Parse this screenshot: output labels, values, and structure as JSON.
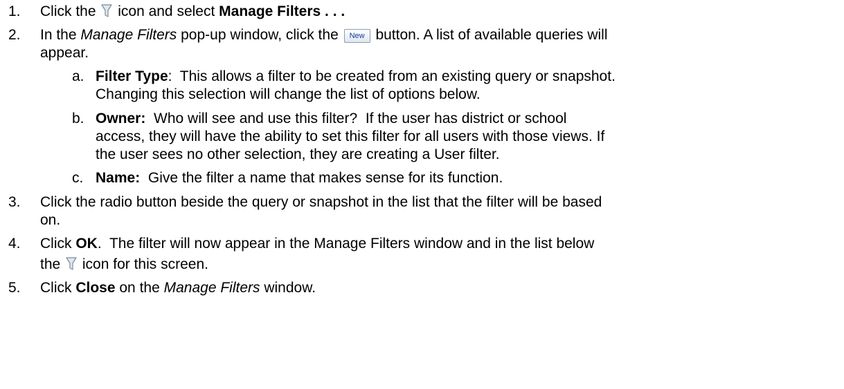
{
  "steps": [
    {
      "number": "1.",
      "before": "Click the",
      "icon": "filter-icon",
      "middle": "icon and select",
      "bold": "Manage Filters . . ."
    },
    {
      "number": "2.",
      "t1": "In the",
      "italic": "Manage Filters",
      "t2": "pop-up window, click the",
      "button_label": "New",
      "t3": "button. A list of available queries will",
      "t4": "appear.",
      "substeps": [
        {
          "letter": "a.",
          "bold": "Filter Type",
          "lines": [
            ":  This allows a filter to be created from an existing query or snapshot.",
            "Changing this selection will change the list of options below."
          ]
        },
        {
          "letter": "b.",
          "bold": "Owner:",
          "lines": [
            "  Who will see and use this filter?  If the user has district or school",
            "access, they will have the ability to set this filter for all users with those views.  If",
            "the user sees no other selection, they are creating a User filter."
          ]
        },
        {
          "letter": "c.",
          "bold": "Name:",
          "lines": [
            "  Give the filter a name that makes sense for its function."
          ]
        }
      ]
    },
    {
      "number": "3.",
      "lines": [
        "Click the radio button beside the query or snapshot in the list that the filter will be based",
        "on."
      ]
    },
    {
      "number": "4.",
      "t1": "Click",
      "bold": "OK",
      "t2": ".  The filter will now appear in the Manage Filters window and in the list below",
      "t3": "the",
      "icon": "filter-icon",
      "t4": "icon for this screen."
    },
    {
      "number": "5.",
      "t1": "Click",
      "bold": "Close",
      "t2": "on the",
      "italic": "Manage Filters",
      "t3": "window."
    }
  ],
  "colors": {
    "text": "#000000",
    "icon_outline": "#7c8c9c",
    "icon_fill": "#dfe7ef",
    "button_text": "#1a3d8f"
  }
}
